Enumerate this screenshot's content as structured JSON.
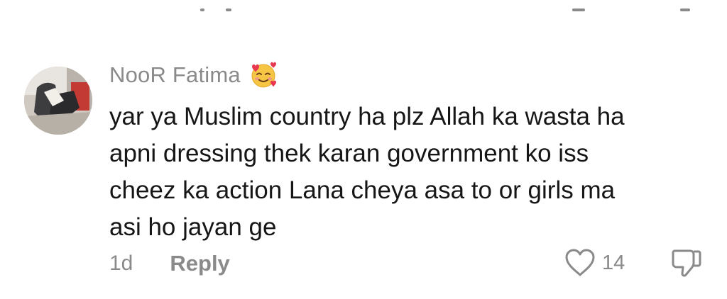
{
  "comment": {
    "username": "NooR Fatima",
    "username_emoji": "smiling-face-with-hearts",
    "text": "yar ya Muslim country ha plz Allah ka wasta ha\napni dressing thek karan government ko iss\ncheez ka action Lana cheya asa to or girls ma\nasi ho jayan ge",
    "time": "1d",
    "reply_label": "Reply",
    "like_count": "14",
    "icons": {
      "like": "heart-outline-icon",
      "dislike": "thumbs-down-icon"
    }
  },
  "colors": {
    "muted": "#8a8a8a",
    "text": "#161616",
    "background": "#ffffff"
  }
}
